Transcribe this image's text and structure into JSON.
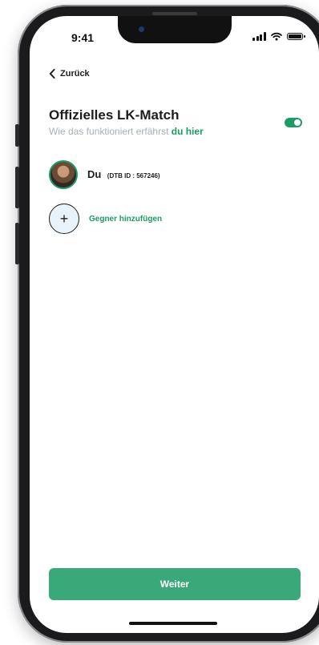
{
  "status_bar": {
    "time": "9:41"
  },
  "nav": {
    "back_label": "Zurück"
  },
  "header": {
    "title": "Offizielles LK-Match",
    "subtitle_prefix": "Wie das funktioniert erfährst ",
    "subtitle_link": "du hier",
    "toggle_on": true
  },
  "player": {
    "name": "Du",
    "id_text": "(DTB ID : 567246)"
  },
  "add_opponent": {
    "label": "Gegner hinzufügen",
    "icon": "+"
  },
  "footer": {
    "button_label": "Weiter"
  },
  "colors": {
    "accent": "#1a9d64",
    "button": "#3aa97a"
  }
}
